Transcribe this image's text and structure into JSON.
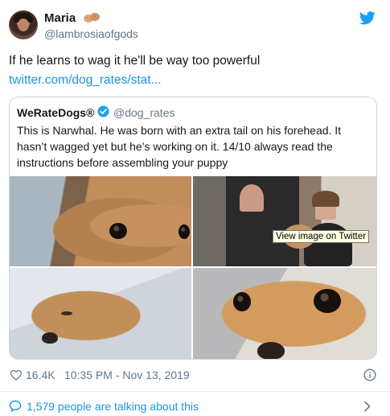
{
  "author": {
    "display_name": "Maria",
    "handle": "@lambrosiaofgods",
    "name_emoji": "peanuts-emoji"
  },
  "tweet": {
    "text": "If he learns to wag it he'll be way too powerful",
    "link": "twitter.com/dog_rates/stat..."
  },
  "quoted_tweet": {
    "display_name": "WeRateDogs®",
    "handle": "@dog_rates",
    "verified": true,
    "text": "This is Narwhal. He was born with an extra tail on his forehead. It hasn’t wagged yet but he’s working on it. 14/10 always read the instructions before assembling your puppy",
    "photos": [
      "puppy-photo-closeup",
      "vet-holding-puppy-photo",
      "puppy-on-blanket-photo",
      "puppy-eyes-photo"
    ]
  },
  "tooltip": {
    "text": "View image on Twitter"
  },
  "footer": {
    "like_count": "16.4K",
    "timestamp": "10:35 PM - Nov 13, 2019"
  },
  "conversation": {
    "text": "1,579 people are talking about this"
  },
  "colors": {
    "link_blue": "#1b95e0",
    "twitter_blue": "#1da1f2",
    "muted_text": "#657786",
    "border": "#ccd6dd"
  }
}
